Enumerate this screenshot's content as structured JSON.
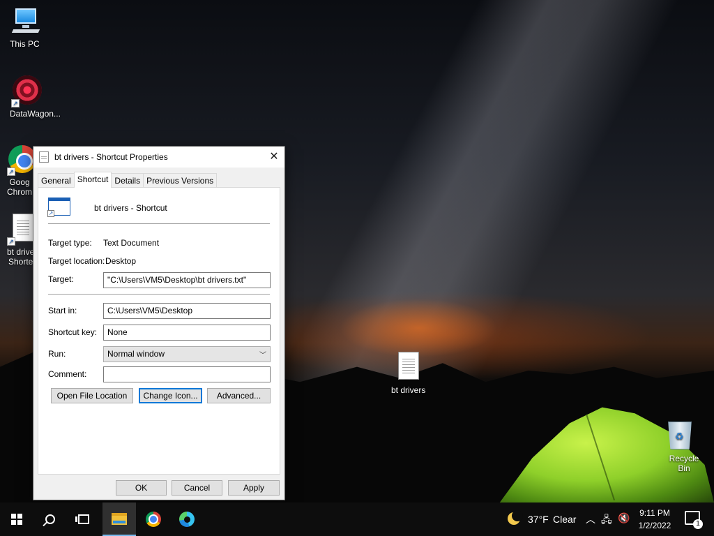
{
  "desktop": {
    "icons": [
      {
        "label": "This PC"
      },
      {
        "label": "DataWagon..."
      },
      {
        "label": "Goog\nChrom"
      },
      {
        "label": "bt drive\nShorte"
      },
      {
        "label": "bt drivers"
      },
      {
        "label": "Recycle Bin"
      }
    ]
  },
  "dialog": {
    "title": "bt drivers - Shortcut Properties",
    "tabs": [
      "General",
      "Shortcut",
      "Details",
      "Previous Versions"
    ],
    "active_tab": "Shortcut",
    "shortcut_name": "bt drivers - Shortcut",
    "target_type_label": "Target type:",
    "target_type_value": "Text Document",
    "target_location_label": "Target location:",
    "target_location_value": "Desktop",
    "target_label": "Target:",
    "target_value": "\"C:\\Users\\VM5\\Desktop\\bt drivers.txt\"",
    "start_in_label": "Start in:",
    "start_in_value": "C:\\Users\\VM5\\Desktop",
    "shortcut_key_label": "Shortcut key:",
    "shortcut_key_value": "None",
    "run_label": "Run:",
    "run_value": "Normal window",
    "comment_label": "Comment:",
    "comment_value": "",
    "open_file_location": "Open File Location",
    "change_icon": "Change Icon...",
    "advanced": "Advanced...",
    "ok": "OK",
    "cancel": "Cancel",
    "apply": "Apply"
  },
  "taskbar": {
    "temperature": "37°F",
    "weather": "Clear",
    "time": "9:11 PM",
    "date": "1/2/2022",
    "notification_count": "1"
  },
  "colors": {
    "accent": "#0078d7",
    "taskbar": "#0d0d0d",
    "dialog_bg": "#f0f0f0"
  }
}
